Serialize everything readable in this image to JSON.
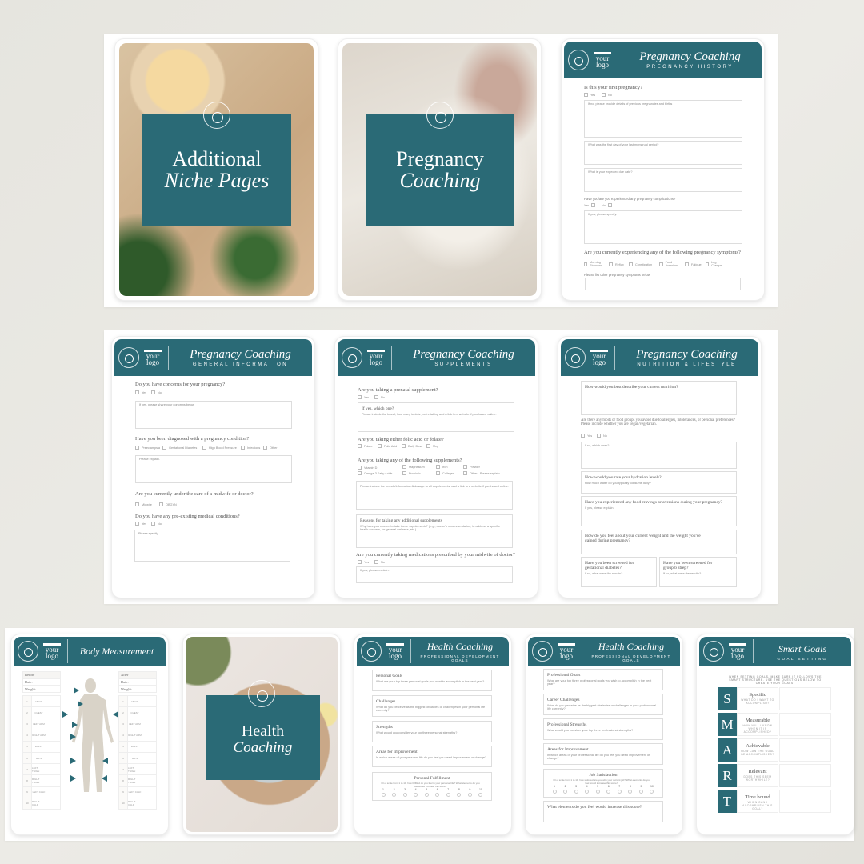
{
  "colors": {
    "brand_teal": "#2a6a76",
    "background": "#e8e7e1"
  },
  "logo": {
    "line1": "your",
    "line2": "logo",
    "icon": "apple-emblem-icon"
  },
  "covers": {
    "niche": {
      "line1": "Additional",
      "line2": "Niche Pages"
    },
    "pregnancy": {
      "line1": "Pregnancy",
      "line2": "Coaching"
    },
    "health": {
      "line1": "Health",
      "line2": "Coaching"
    }
  },
  "pregnancy_history": {
    "title": "Pregnancy Coaching",
    "subtitle": "PREGNANCY HISTORY",
    "q1": "Is this your first pregnancy?",
    "yes": "Yes",
    "no": "No",
    "box1": "If no, please provide details of previous pregnancies and births",
    "box2": "What was the first day of your last menstrual period?",
    "box3": "What is your expected due date?",
    "q2": "Have you/are you experienced any pregnancy complications?",
    "box4": "If yes, please specify.",
    "q3": "Are you currently experiencing any of the following pregnancy symptoms?",
    "symptoms": [
      "Morning Sickness",
      "Reflux",
      "Constipation",
      "Food Aversions",
      "Fatigue",
      "Leg Cramps"
    ],
    "other_label": "Please list other pregnancy symptoms below"
  },
  "general_info": {
    "title": "Pregnancy Coaching",
    "subtitle": "GENERAL INFORMATION",
    "q1": "Do you have concerns for your pregnancy?",
    "yes": "Yes",
    "no": "No",
    "box1": "If yes, please share your concerns below",
    "q2": "Have you been diagnosed with a pregnancy condition?",
    "conditions": [
      "Preeclampsia",
      "Gestational Diabetes",
      "High Blood Pressure",
      "Infections",
      "Other"
    ],
    "box2": "Please explain.",
    "q3": "Are you currently under the care of a midwife or doctor?",
    "care": [
      "Midwife",
      "OBGYN"
    ],
    "q4": "Do you have any pre-existing medical conditions?",
    "box3": "Please specify."
  },
  "supplements": {
    "title": "Pregnancy Coaching",
    "subtitle": "SUPPLEMENTS",
    "q1": "Are you taking a prenatal supplement?",
    "yes": "Yes",
    "no": "No",
    "box1_title": "If yes, which one?",
    "box1_sub": "Please include the brand, how many tablets you're taking and a link to a website if purchased online.",
    "q2": "Are you taking either folic acid or folate?",
    "folic": [
      "Folate",
      "Folic Acid",
      "Daily Dose",
      "Mcg"
    ],
    "q3": "Are you taking any of the following supplements?",
    "supps": [
      "Vitamin D",
      "Magnesium",
      "Iron",
      "Powder",
      "Omega-3 Fatty Acids",
      "Probiotic",
      "Collagen",
      "Other - Please explain"
    ],
    "box2": "Please include the brands/information & dosage to all supplements, and a link to a website if purchased online.",
    "box3_title": "Reasons for taking any additional supplements",
    "box3_sub": "Why have you chosen to take these supplements? (e.g., doctor's recommendation, to address a specific health concern, for general wellness, etc.)",
    "q4": "Are you currently taking medications prescribed by your midwife of doctor?",
    "box4": "If yes, please explain."
  },
  "nutrition": {
    "title": "Pregnancy Coaching",
    "subtitle": "NUTRITION & LIFESTYLE",
    "box1": "How would you best describe your current nutrition?",
    "q1": "Are there any foods or food groups you avoid due to allergies, intolerances, or personal preferences? Please include whether you are vegan/vegetarian.",
    "yes": "Yes",
    "no": "No",
    "box2": "If so, which ones?",
    "box3_title": "How would you rate your hydration levels?",
    "box3_sub": "How much water do you typically consume daily?",
    "box4_title": "Have you experienced any food cravings or aversions during your pregnancy?",
    "box4_sub": "If yes, please explain.",
    "box5": "How do you feel about your current weight and the weight you've gained during pregnancy?",
    "box6_title": "Have you been screened for gestational diabetes?",
    "box6_sub": "If so, what were the results?",
    "box7_title": "Have you been screened for group b strep?",
    "box7_sub": "If so, what were the results?"
  },
  "body_measurement": {
    "title": "Body Measurement",
    "before": "Before",
    "after": "After",
    "date": "Date:",
    "weight": "Weight:",
    "parts": [
      "NECK",
      "CHEST",
      "LEFT ARM",
      "RIGHT ARM",
      "WAIST",
      "HIPS",
      "LEFT THIGH",
      "RIGHT THIGH",
      "LEFT CALF",
      "RIGHT CALF"
    ]
  },
  "personal_goals": {
    "title": "Health Coaching",
    "subtitle": "PROFESSIONAL DEVELOPMENT GOALS",
    "boxes": [
      {
        "t": "Personal Goals",
        "s": "What are your top three personal goals you want to accomplish in the next year?"
      },
      {
        "t": "Challenges",
        "s": "What do you perceive as the biggest obstacles or challenges in your personal life currently?"
      },
      {
        "t": "Strengths",
        "s": "What would you consider your top three personal strengths?"
      },
      {
        "t": "Areas for Improvement",
        "s": "In which areas of your personal life do you feel you need improvement or change?"
      }
    ],
    "scale_title": "Personal Fulfillment",
    "scale_sub": "On a scale from 1 to 10, how fulfilled do you feel in your personal life? What elements do you feel would increase this score?",
    "scale": [
      "1",
      "2",
      "3",
      "4",
      "5",
      "6",
      "7",
      "8",
      "9",
      "10"
    ]
  },
  "professional_goals": {
    "title": "Health Coaching",
    "subtitle": "PROFESSIONAL DEVELOPMENT GOALS",
    "boxes": [
      {
        "t": "Professional Goals",
        "s": "What are your top three professional goals you wish to accomplish in the next year?"
      },
      {
        "t": "Career Challenges",
        "s": "What do you perceive as the biggest obstacles or challenges in your professional life currently?"
      },
      {
        "t": "Professional Strengths",
        "s": "What would you consider your top three professional strengths?"
      },
      {
        "t": "Areas for Improvement",
        "s": "In which areas of your professional life do you feel you need improvement or change?"
      }
    ],
    "scale_title": "Job Satisfaction",
    "scale_sub": "On a scale from 1 to 10, how satisfied are you with your current job? What elements do you feel would increase this score?",
    "scale": [
      "1",
      "2",
      "3",
      "4",
      "5",
      "6",
      "7",
      "8",
      "9",
      "10"
    ],
    "last_box": "What elements do you feel would increase this score?"
  },
  "smart_goals": {
    "title": "Smart Goals",
    "subtitle": "GOAL SETTING",
    "intro": "WHEN SETTING GOALS, MAKE SURE IT FOLLOWS THE SMART STRUCTURE. USE THE QUESTIONS BELOW TO CREATE YOUR GOALS.",
    "rows": [
      {
        "l": "S",
        "t": "Specific",
        "s": "WHAT DO I WANT TO ACCOMPLISH?"
      },
      {
        "l": "M",
        "t": "Measurable",
        "s": "HOW WILL I KNOW WHEN IT IS ACCOMPLISHED?"
      },
      {
        "l": "A",
        "t": "Achievable",
        "s": "HOW CAN THE GOAL BE ACCOMPLISHED?"
      },
      {
        "l": "R",
        "t": "Relevant",
        "s": "DOES THIS SEEM WORTHWHILE?"
      },
      {
        "l": "T",
        "t": "Time bound",
        "s": "WHEN CAN I ACCOMPLISH THIS GOAL?"
      }
    ]
  }
}
